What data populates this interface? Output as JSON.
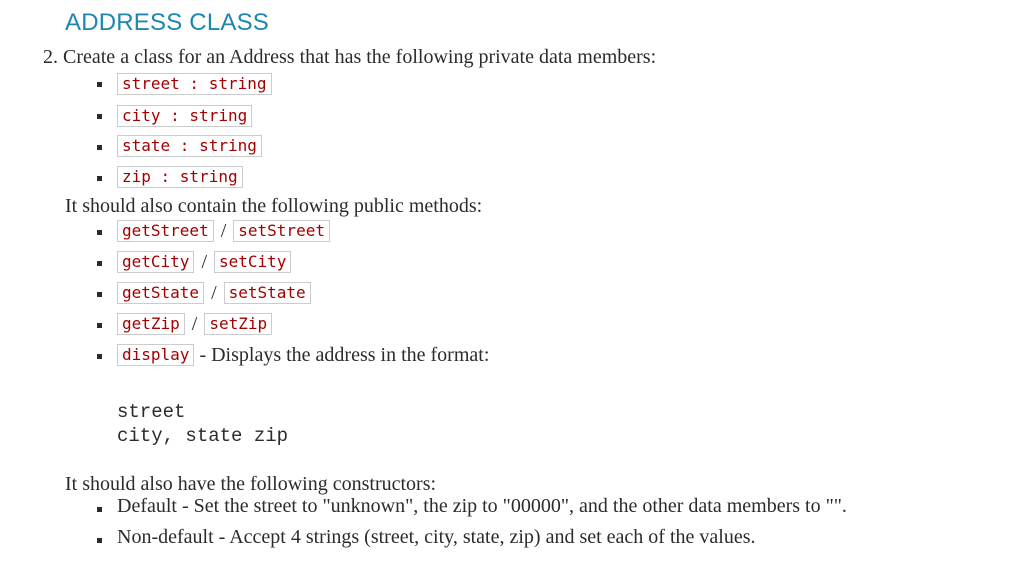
{
  "heading": "ADDRESS CLASS",
  "intro": "2. Create a class for an Address that has the following private data members:",
  "data_members": [
    "street : string",
    "city : string",
    "state : string",
    "zip : string"
  ],
  "methods_intro": "It should also contain the following public methods:",
  "methods": [
    {
      "getter": "getStreet",
      "separator": "/",
      "setter": "setStreet"
    },
    {
      "getter": "getCity",
      "separator": "/",
      "setter": "setCity"
    },
    {
      "getter": "getState",
      "separator": "/",
      "setter": "setState"
    },
    {
      "getter": "getZip",
      "separator": "/",
      "setter": "setZip"
    }
  ],
  "display_method": {
    "name": "display",
    "description": "- Displays the address in the format:"
  },
  "format_lines": [
    "street",
    "city, state zip"
  ],
  "constructors_intro": "It should also have the following constructors:",
  "constructors": [
    "Default - Set the street to \"unknown\", the zip to \"00000\", and the other data members to \"\".",
    "Non-default - Accept 4 strings (street, city, state, zip) and set each of the values."
  ]
}
